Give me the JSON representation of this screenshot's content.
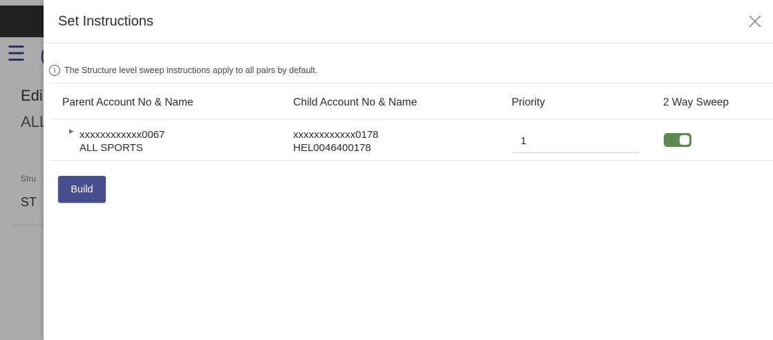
{
  "background": {
    "edit_partial": "Edi",
    "all_partial": "ALL",
    "stru_partial": "Stru",
    "st_partial": "ST",
    "cut_partial": "("
  },
  "modal": {
    "title": "Set Instructions",
    "info_text": "The Structure level sweep instructions apply to all pairs by default.",
    "columns": [
      "Parent Account No & Name",
      "Child Account No & Name",
      "Priority",
      "2 Way Sweep"
    ],
    "rows": [
      {
        "parent_account": "xxxxxxxxxxxx0067",
        "parent_name": "ALL SPORTS",
        "child_account": "xxxxxxxxxxxx0178",
        "child_name": "HEL0046400178",
        "priority": "1",
        "two_way_sweep": true
      }
    ],
    "build_label": "Build"
  },
  "colors": {
    "primary_button": "#474d8d",
    "toggle_on": "#5e8a4e",
    "top_bar": "#2e2e33"
  },
  "icons": [
    "hamburger-icon",
    "close-icon",
    "info-icon",
    "caret-right-icon"
  ]
}
